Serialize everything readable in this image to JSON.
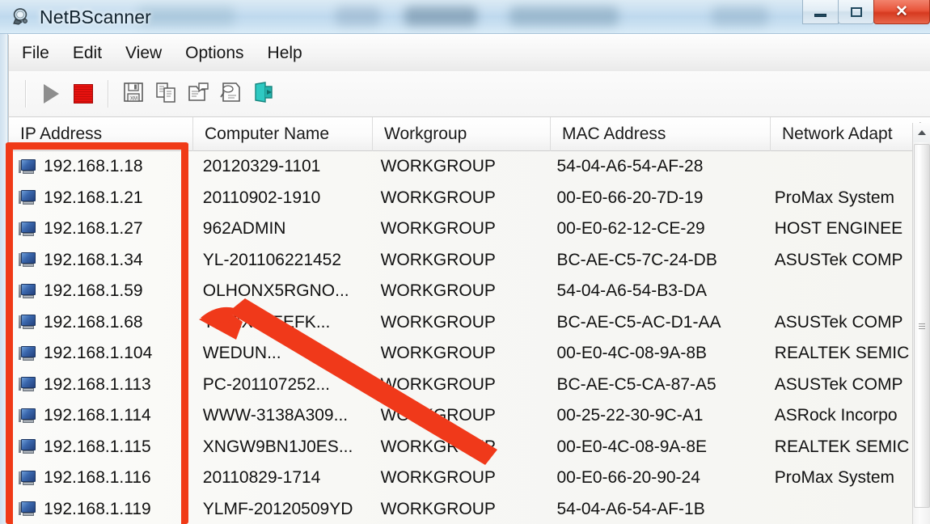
{
  "window": {
    "title": "NetBScanner",
    "icon": "magnifier-network-icon",
    "controls": {
      "minimize": "–",
      "maximize": "□",
      "close": "✕"
    }
  },
  "menu": {
    "items": [
      {
        "label": "File",
        "name": "menu-file"
      },
      {
        "label": "Edit",
        "name": "menu-edit"
      },
      {
        "label": "View",
        "name": "menu-view"
      },
      {
        "label": "Options",
        "name": "menu-options"
      },
      {
        "label": "Help",
        "name": "menu-help"
      }
    ]
  },
  "toolbar": {
    "buttons": [
      {
        "name": "start-scan-button",
        "icon": "play-triangle-icon",
        "state": "disabled"
      },
      {
        "name": "stop-scan-button",
        "icon": "stop-square-icon",
        "state": "enabled"
      },
      {
        "name": "save-button",
        "icon": "floppy-disk-icon",
        "state": "enabled"
      },
      {
        "name": "copy-button",
        "icon": "copy-pages-icon",
        "state": "enabled"
      },
      {
        "name": "properties-button",
        "icon": "properties-icon",
        "state": "enabled"
      },
      {
        "name": "html-report-button",
        "icon": "html-report-icon",
        "state": "enabled"
      },
      {
        "name": "exit-button",
        "icon": "exit-door-icon",
        "state": "enabled"
      }
    ]
  },
  "list": {
    "columns": [
      {
        "label": "IP Address",
        "name": "column-header-ip-address",
        "sorted": true
      },
      {
        "label": "Computer Name",
        "name": "column-header-computer-name",
        "sorted": false
      },
      {
        "label": "Workgroup",
        "name": "column-header-workgroup",
        "sorted": false
      },
      {
        "label": "MAC Address",
        "name": "column-header-mac-address",
        "sorted": false
      },
      {
        "label": "Network Adapt",
        "name": "column-header-network-adapter",
        "sorted": false
      }
    ],
    "sort_caret": "⌃",
    "rows": [
      {
        "ip": "192.168.1.18",
        "computer_name": "20120329-1101",
        "workgroup": "WORKGROUP",
        "mac": "54-04-A6-54-AF-28",
        "adapter": ""
      },
      {
        "ip": "192.168.1.21",
        "computer_name": "20110902-1910",
        "workgroup": "WORKGROUP",
        "mac": "00-E0-66-20-7D-19",
        "adapter": "ProMax System"
      },
      {
        "ip": "192.168.1.27",
        "computer_name": "962ADMIN",
        "workgroup": "WORKGROUP",
        "mac": "00-E0-62-12-CE-29",
        "adapter": "HOST ENGINEE"
      },
      {
        "ip": "192.168.1.34",
        "computer_name": "YL-201106221452",
        "workgroup": "WORKGROUP",
        "mac": "BC-AE-C5-7C-24-DB",
        "adapter": "ASUSTek COMP"
      },
      {
        "ip": "192.168.1.59",
        "computer_name": "OLHONX5RGNO...",
        "workgroup": "WORKGROUP",
        "mac": "54-04-A6-54-B3-DA",
        "adapter": ""
      },
      {
        "ip": "192.168.1.68",
        "computer_name": "Y…ZX92EEFK...",
        "workgroup": "WORKGROUP",
        "mac": "BC-AE-C5-AC-D1-AA",
        "adapter": "ASUSTek COMP"
      },
      {
        "ip": "192.168.1.104",
        "computer_name": "WEDUN...",
        "workgroup": "WORKGROUP",
        "mac": "00-E0-4C-08-9A-8B",
        "adapter": "REALTEK SEMIC"
      },
      {
        "ip": "192.168.1.113",
        "computer_name": "PC-201107252...",
        "workgroup": "WORKGROUP",
        "mac": "BC-AE-C5-CA-87-A5",
        "adapter": "ASUSTek COMP"
      },
      {
        "ip": "192.168.1.114",
        "computer_name": "WWW-3138A309...",
        "workgroup": "WORKGROUP",
        "mac": "00-25-22-30-9C-A1",
        "adapter": "ASRock Incorpo"
      },
      {
        "ip": "192.168.1.115",
        "computer_name": "XNGW9BN1J0ES...",
        "workgroup": "WORKGROUP",
        "mac": "00-E0-4C-08-9A-8E",
        "adapter": "REALTEK SEMIC"
      },
      {
        "ip": "192.168.1.116",
        "computer_name": "20110829-1714",
        "workgroup": "WORKGROUP",
        "mac": "00-E0-66-20-90-24",
        "adapter": "ProMax System"
      },
      {
        "ip": "192.168.1.119",
        "computer_name": "YLMF-20120509YD",
        "workgroup": "WORKGROUP",
        "mac": "54-04-A6-54-AF-1B",
        "adapter": ""
      }
    ],
    "row_icon": "computer-monitor-icon"
  },
  "scrollbar": {
    "up_arrow": "scroll-up-arrow-icon",
    "thumb": "scroll-thumb"
  },
  "annotations": {
    "highlight_color": "#F03A17",
    "box": {
      "target": "ip-address-column"
    },
    "arrow": {
      "target": "computer-name-column"
    }
  }
}
